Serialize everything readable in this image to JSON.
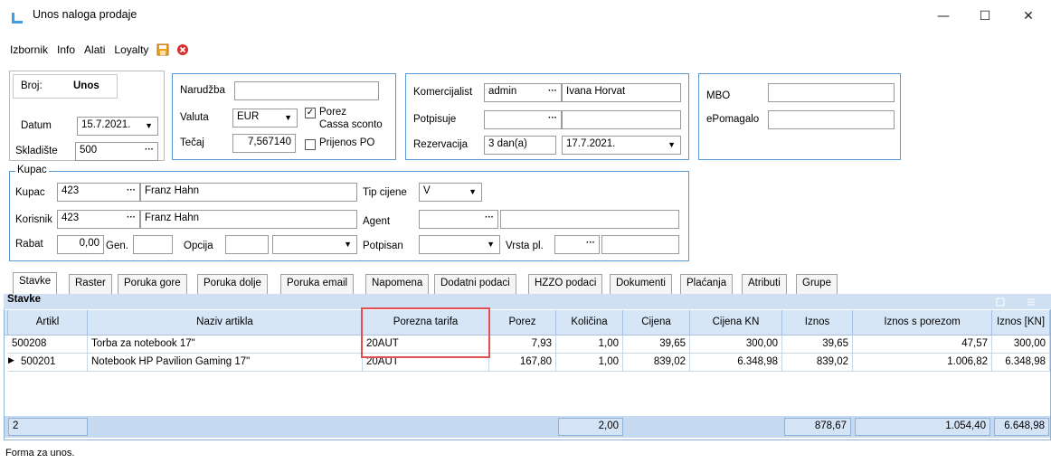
{
  "window": {
    "title": "Unos naloga prodaje",
    "min": "—",
    "max": "☐",
    "close": "✕"
  },
  "menu": [
    "Izbornik",
    "Info",
    "Alati",
    "Loyalty"
  ],
  "header": {
    "broj_label": "Broj:",
    "broj_value": "Unos",
    "datum_label": "Datum",
    "datum_value": "15.7.2021.",
    "skladiste_label": "Skladište",
    "skladiste_value": "500",
    "narudzba_label": "Narudžba",
    "narudzba_value": "",
    "valuta_label": "Valuta",
    "valuta_value": "EUR",
    "tecaj_label": "Tečaj",
    "tecaj_value": "7,567140",
    "porez_label": "Porez",
    "porez_checked": true,
    "cassa_label": "Cassa sconto",
    "prijenos_label": "Prijenos PO",
    "komercijalist_label": "Komercijalist",
    "komercijalist_value": "admin",
    "komercijalist_name": "Ivana Horvat",
    "potpisuje_label": "Potpisuje",
    "rezervacija_label": "Rezervacija",
    "rezervacija_value": "3 dan(a)",
    "rezervacija_date": "17.7.2021.",
    "mbo_label": "MBO",
    "epomagalo_label": "ePomagalo"
  },
  "kupac": {
    "group_label": "Kupac",
    "kupac_label": "Kupac",
    "kupac_code": "423",
    "kupac_name": "Franz Hahn",
    "korisnik_label": "Korisnik",
    "korisnik_code": "423",
    "korisnik_name": "Franz Hahn",
    "rabat_label": "Rabat",
    "rabat_value": "0,00",
    "gen_label": "Gen.",
    "opcija_label": "Opcija",
    "tip_cijene_label": "Tip cijene",
    "tip_cijene_value": "V",
    "agent_label": "Agent",
    "potpisan_label": "Potpisan",
    "vrsta_pl_label": "Vrsta pl."
  },
  "tabs": [
    "Stavke",
    "Raster",
    "Poruka gore",
    "Poruka dolje",
    "Poruka email",
    "Napomena",
    "Dodatni podaci",
    "HZZO podaci",
    "Dokumenti",
    "Plaćanja",
    "Atributi",
    "Grupe"
  ],
  "grid": {
    "title": "Stavke",
    "columns": [
      "Artikl",
      "Naziv artikla",
      "Porezna tarifa",
      "Porez",
      "Količina",
      "Cijena",
      "Cijena KN",
      "Iznos",
      "Iznos s porezom",
      "Iznos [KN]"
    ],
    "rows": [
      [
        "500208",
        "Torba za notebook 17\"",
        "20AUT",
        "7,93",
        "1,00",
        "39,65",
        "300,00",
        "39,65",
        "47,57",
        "300,00"
      ],
      [
        "500201",
        "Notebook HP Pavilion Gaming 17\"",
        "20AUT",
        "167,80",
        "1,00",
        "839,02",
        "6.348,98",
        "839,02",
        "1.006,82",
        "6.348,98"
      ]
    ],
    "footer": {
      "count": "2",
      "kolicina": "2,00",
      "iznos": "878,67",
      "iznos_s_porezom": "1.054,40",
      "iznos_kn": "6.648,98"
    }
  },
  "status": "Forma za unos.",
  "colors": {
    "accent": "#5b9bd5",
    "grid_header": "#d7e6f7",
    "highlight_box": "#e05050"
  }
}
